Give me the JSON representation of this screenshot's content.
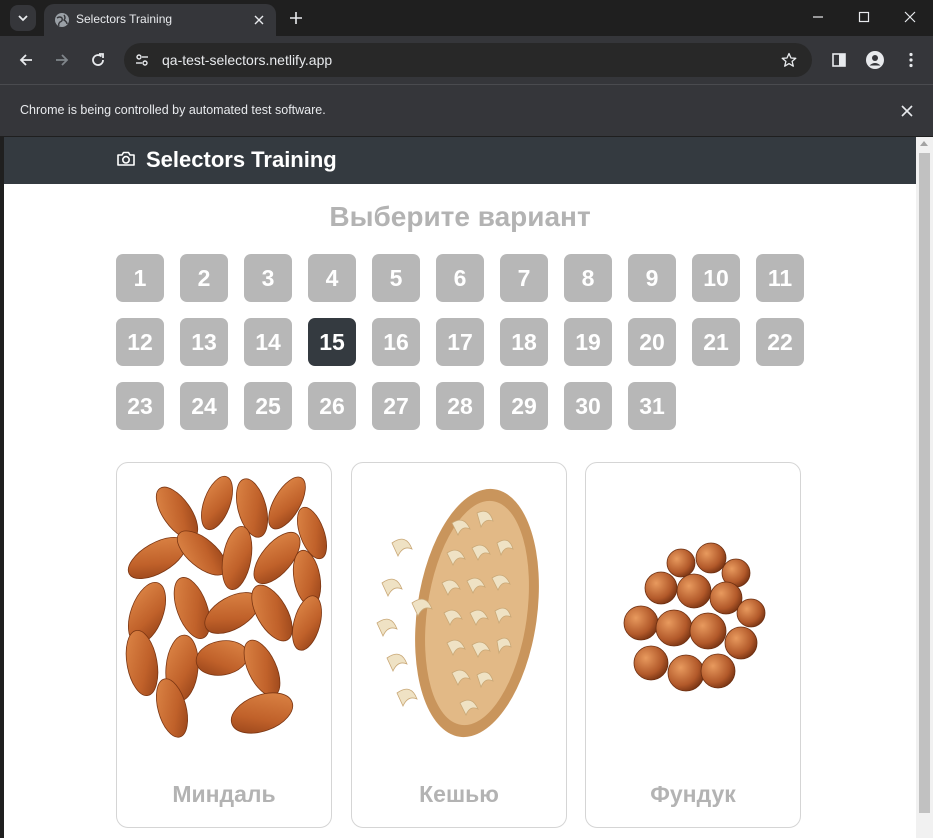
{
  "browser": {
    "tab_title": "Selectors Training",
    "url": "qa-test-selectors.netlify.app",
    "infobar_text": "Chrome is being controlled by automated test software."
  },
  "header": {
    "title": "Selectors Training",
    "icon": "camera-icon"
  },
  "main": {
    "heading": "Выберите вариант",
    "variants": [
      "1",
      "2",
      "3",
      "4",
      "5",
      "6",
      "7",
      "8",
      "9",
      "10",
      "11",
      "12",
      "13",
      "14",
      "15",
      "16",
      "17",
      "18",
      "19",
      "20",
      "21",
      "22",
      "23",
      "24",
      "25",
      "26",
      "27",
      "28",
      "29",
      "30",
      "31"
    ],
    "selected_variant": "15"
  },
  "cards": [
    {
      "label": "Миндаль",
      "image": "almonds-image"
    },
    {
      "label": "Кешью",
      "image": "cashews-image"
    },
    {
      "label": "Фундук",
      "image": "hazelnuts-image"
    }
  ],
  "colors": {
    "header_bg": "#343a40",
    "variant_bg": "#b7b7b7",
    "variant_active_bg": "#343a40",
    "muted_text": "#b3b3b3"
  }
}
